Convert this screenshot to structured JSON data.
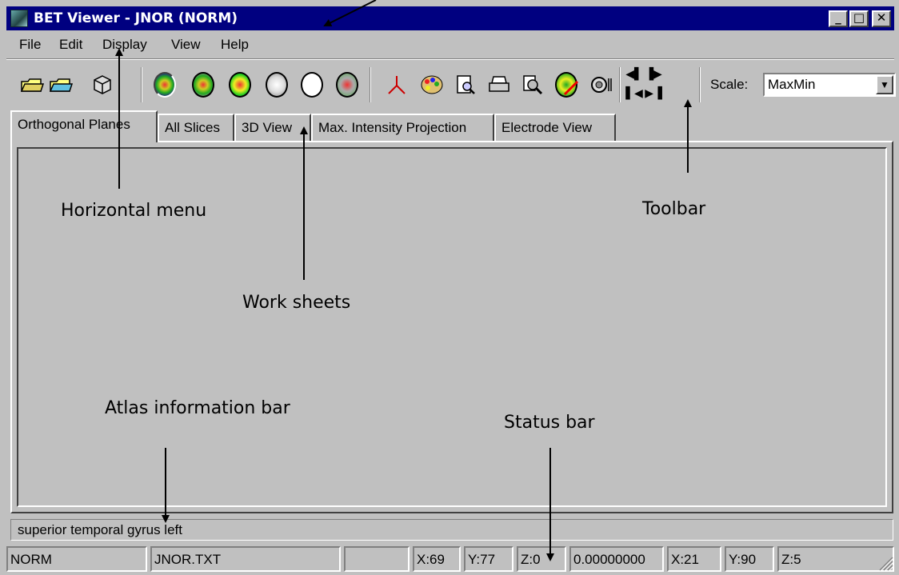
{
  "window": {
    "title": "BET Viewer - JNOR (NORM)",
    "caption_buttons": {
      "minimize": "_",
      "maximize": "□",
      "close": "✕"
    }
  },
  "menu": {
    "items": [
      {
        "label": "File"
      },
      {
        "label": "Edit"
      },
      {
        "label": "Display"
      },
      {
        "label": "View"
      },
      {
        "label": "Help"
      }
    ]
  },
  "toolbar": {
    "icons": [
      "open-folder-icon",
      "open-image-folder-icon",
      "cube-icon",
      "brain-view-1-icon",
      "brain-view-2-icon",
      "brain-view-3-icon",
      "brain-view-4-icon",
      "brain-view-5-icon",
      "brain-view-6-icon",
      "crosshair-icon",
      "palette-icon",
      "preview-icon",
      "print-icon",
      "zoom-icon",
      "brain-tool-icon",
      "record-icon",
      "prev-frame-icon",
      "next-frame-icon",
      "first-frame-icon",
      "last-frame-icon"
    ],
    "scale_label": "Scale:",
    "scale_value": "MaxMin"
  },
  "tabs": [
    {
      "label": "Orthogonal Planes",
      "active": true
    },
    {
      "label": "All Slices"
    },
    {
      "label": "3D View"
    },
    {
      "label": "Max. Intensity Projection"
    },
    {
      "label": "Electrode View"
    }
  ],
  "atlas_info": "superior temporal gyrus left",
  "status": {
    "cells": [
      "NORM",
      "JNOR.TXT",
      "",
      "X:69",
      "Y:77",
      "Z:0",
      "0.00000000",
      "X:21",
      "Y:90",
      "Z:5"
    ]
  },
  "annotations": {
    "menu": "Horizontal menu",
    "toolbar": "Toolbar",
    "worksheets": "Work sheets",
    "atlas": "Atlas information bar",
    "status": "Status bar"
  },
  "colors": {
    "title_bar": "#000080",
    "face": "#c0c0c0",
    "highlight": "#ffffff",
    "shadow": "#808080"
  }
}
